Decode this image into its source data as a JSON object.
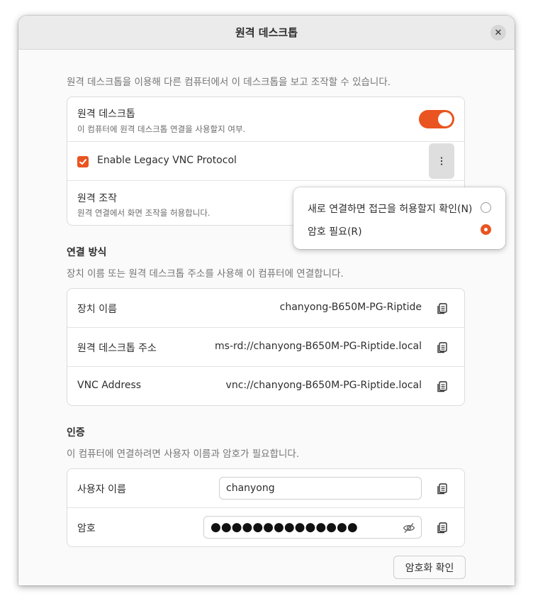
{
  "window": {
    "title": "원격 데스크톱"
  },
  "intro": "원격 데스크톱을 이용해 다른 컴퓨터에서 이 데스크톱을 보고 조작할 수 있습니다.",
  "remote_desktop": {
    "title": "원격 데스크톱",
    "subtitle": "이 컴퓨터에 원격 데스크톱 연결을 사용할지 여부.",
    "enabled": true
  },
  "legacy_vnc": {
    "label": "Enable Legacy VNC Protocol",
    "checked": true
  },
  "remote_control": {
    "title": "원격 조작",
    "subtitle": "원격 연결에서 화면 조작을 허용합니다."
  },
  "popover": {
    "options": [
      {
        "label": "새로 연결하면 접근을 허용할지 확인(N)",
        "selected": false
      },
      {
        "label": "암호 필요(R)",
        "selected": true
      }
    ]
  },
  "connection": {
    "title": "연결 방식",
    "desc": "장치 이름 또는 원격 데스크톱 주소를 사용해 이 컴퓨터에 연결합니다.",
    "rows": [
      {
        "label": "장치 이름",
        "value": "chanyong-B650M-PG-Riptide"
      },
      {
        "label": "원격 데스크톱 주소",
        "value": "ms-rd://chanyong-B650M-PG-Riptide.local"
      },
      {
        "label": "VNC Address",
        "value": "vnc://chanyong-B650M-PG-Riptide.local"
      }
    ]
  },
  "auth": {
    "title": "인증",
    "desc": "이 컴퓨터에 연결하려면 사용자 이름과 암호가 필요합니다.",
    "username_label": "사용자 이름",
    "username_value": "chanyong",
    "password_label": "암호",
    "password_value": "●●●●●●●●●●●●●●",
    "verify_button": "암호화 확인"
  },
  "colors": {
    "accent": "#e95420"
  }
}
